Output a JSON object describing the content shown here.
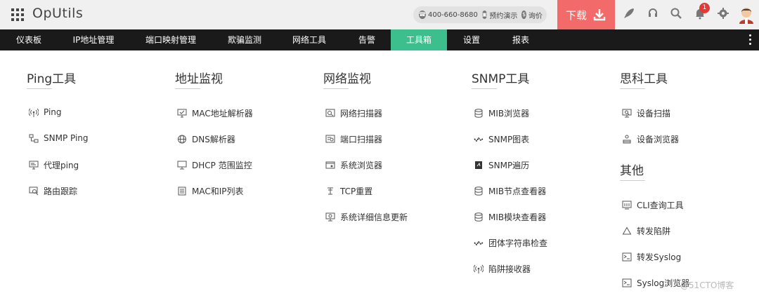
{
  "header": {
    "app_title": "OpUtils",
    "phone": "400-660-8680",
    "demo": "预约演示",
    "inquiry": "询价",
    "download": "下载",
    "notification_count": "1"
  },
  "nav": {
    "items": [
      "仪表板",
      "IP地址管理",
      "端口映射管理",
      "欺骗监测",
      "网络工具",
      "告警",
      "工具箱",
      "设置",
      "报表"
    ],
    "active": "工具箱"
  },
  "columns": {
    "ping": {
      "title": "Ping工具",
      "items": [
        "Ping",
        "SNMP Ping",
        "代理ping",
        "路由跟踪"
      ]
    },
    "address": {
      "title": "地址监视",
      "items": [
        "MAC地址解析器",
        "DNS解析器",
        "DHCP 范围监控",
        "MAC和IP列表"
      ]
    },
    "network": {
      "title": "网络监视",
      "items": [
        "网络扫描器",
        "端口扫描器",
        "系统浏览器",
        "TCP重置",
        "系统详细信息更新"
      ]
    },
    "snmp": {
      "title": "SNMP工具",
      "items": [
        "MIB浏览器",
        "SNMP图表",
        "SNMP遍历",
        "MIB节点查看器",
        "MIB模块查看器",
        "团体字符串检查",
        "陷阱接收器"
      ]
    },
    "cisco": {
      "title": "思科工具",
      "items": [
        "设备扫描",
        "设备浏览器"
      ]
    },
    "other": {
      "title": "其他",
      "items": [
        "CLI查询工具",
        "转发陷阱",
        "转发Syslog",
        "Syslog浏览器"
      ]
    }
  },
  "watermark": "@51CTO博客",
  "icons": {
    "ping": [
      "antenna-icon",
      "network-nodes-icon",
      "proxy-icon",
      "traceroute-icon"
    ],
    "address": [
      "monitor-icon",
      "globe-icon",
      "desktop-icon",
      "list-icon"
    ],
    "network": [
      "scanner-icon",
      "port-scan-icon",
      "system-browser-icon",
      "reset-icon",
      "info-update-icon"
    ],
    "snmp": [
      "database-icon",
      "chart-icon",
      "walk-icon",
      "database-icon",
      "database-icon",
      "chart-icon",
      "antenna-icon"
    ],
    "cisco": [
      "device-scan-icon",
      "device-browser-icon"
    ],
    "other": [
      "cli-icon",
      "triangle-icon",
      "terminal-icon",
      "terminal-icon"
    ]
  },
  "colors": {
    "accent": "#3cbf8c",
    "download": "#f36a6a",
    "navbar": "#1a1a1a"
  }
}
